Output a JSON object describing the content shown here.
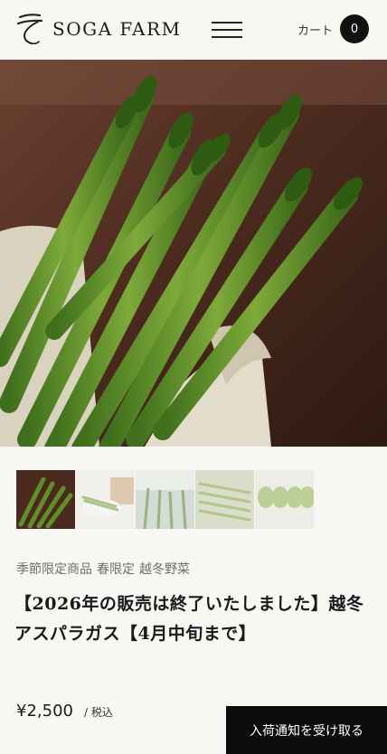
{
  "header": {
    "brand": "SOGA FARM",
    "cart_label": "カート",
    "cart_count": "0"
  },
  "hero": {
    "alt": "アスパラガス"
  },
  "tags": [
    "季節限定商品",
    "春限定",
    "越冬野菜"
  ],
  "product": {
    "title": "【2026年の販売は終了いたしました】越冬アスパラガス【4月中旬まで】",
    "price": "¥2,500",
    "tax_label": "/ 税込"
  },
  "cta": {
    "notify_label": "入荷通知を受け取る"
  },
  "colors": {
    "accent": "#0d0d0d",
    "background": "#f8f7f4",
    "tag_text": "#6f6f6f"
  }
}
